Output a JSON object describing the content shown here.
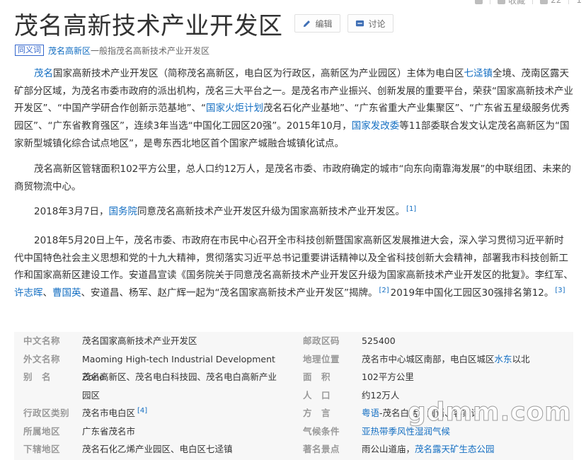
{
  "toolbar": {
    "collect_label": "收藏",
    "like_count": "22",
    "share_count": "1"
  },
  "header": {
    "title": "茂名高新技术产业开发区",
    "edit_label": "编辑",
    "discuss_label": "讨论"
  },
  "synonym": {
    "tag": "同义词",
    "term": "茂名高新区",
    "rest": "一般指茂名高新技术产业开发区"
  },
  "p1": {
    "s1": "茂名",
    "s2": "国家高新技术产业开发区（简称茂名高新区，电白区为行政区，高新区为产业园区）主体为电白区",
    "s3": "七迳镇",
    "s4": "全境、茂南区露天矿部分区域，为茂名市委市政府的派出机构，茂名三大平台之一。是茂名市产业振兴、创新发展的重要平台，荣获“国家高新技术产业开发区”、“中国产学研合作创新示范基地”、“",
    "s5": "国家火炬计划",
    "s6": "茂名石化产业基地”、“广东省重大产业集聚区”、“广东省五星级服务优秀园区”、“广东省教育强区”，连续3年当选“中国化工园区20强”。2015年10月，",
    "s7": "国家发改委",
    "s8": "等11部委联合发文认定茂名高新区为“国家新型城镇化综合试点地区”，是粤东西北地区首个国家产城融合城镇化试点。"
  },
  "p2": {
    "text": "茂名高新区管辖面积102平方公里，总人口约12万人，是茂名市委、市政府确定的城市“向东向南靠海发展”的中联组团、未来的商贸物流中心。"
  },
  "p3": {
    "s1": "2018年3月7日，",
    "s2": "国务院",
    "s3": "同意茂名高新技术产业开发区升级为国家高新技术产业开发区。",
    "ref": "[1]"
  },
  "p4": {
    "s1": "2018年5月20日上午，茂名市委、市政府在市民中心召开全市科技创新暨国家高新区发展推进大会，深入学习贯彻习近平新时代中国特色社会主义思想和党的十九大精神，贯彻落实习近平总书记重要讲话精神以及全省科技创新大会精神，部署我市科技创新工作和国家高新区建设工作。安道昌宣读《国务院关于同意茂名高新技术产业开发区升级为国家高新技术产业开发区的批复》。李红军、",
    "s2": "许志晖",
    "s3": "、",
    "s4": "曹国英",
    "s5": "、安道昌、杨军、赵广辉一起为“茂名国家高新技术产业开发区”揭牌。",
    "ref1": "[2]",
    "s6": "2019年中国化工园区30强排名第12。",
    "ref2": "[3]"
  },
  "infobox": {
    "left": [
      {
        "label": "中文名称",
        "value": "茂名国家高新技术产业开发区"
      },
      {
        "label": "外文名称",
        "value": "Maoming High-tech Industrial Development Zone"
      },
      {
        "label": "别　名",
        "value": "茂名高新区、茂名电白科技园、茂名电白高新产业园区"
      },
      {
        "label": "行政区类别",
        "value": "茂名市电白区",
        "ref": "[4]"
      },
      {
        "label": "所属地区",
        "value": "广东省茂名市"
      },
      {
        "label": "下辖地区",
        "value": "茂名石化乙烯产业园区、电白区七迳镇"
      }
    ],
    "right": [
      {
        "label": "邮政区码",
        "value": "525400"
      },
      {
        "label": "地理位置",
        "value_a": "茂名市中心城区南部，电白区城区",
        "value_link": "水东",
        "value_b": "以北"
      },
      {
        "label": "面　积",
        "value": "102平方公里"
      },
      {
        "label": "人　口",
        "value": "约12万人"
      },
      {
        "label": "方　言",
        "value_link": "粤语",
        "value_b": "-茂名白话、闽语、客家话"
      },
      {
        "label": "气候条件",
        "value_link": "亚热带季风性湿润气候"
      },
      {
        "label": "著名景点",
        "value_a": "雨公山道庙，",
        "value_link": "茂名露天矿生态公园"
      }
    ]
  },
  "watermark": "gdmm.com"
}
